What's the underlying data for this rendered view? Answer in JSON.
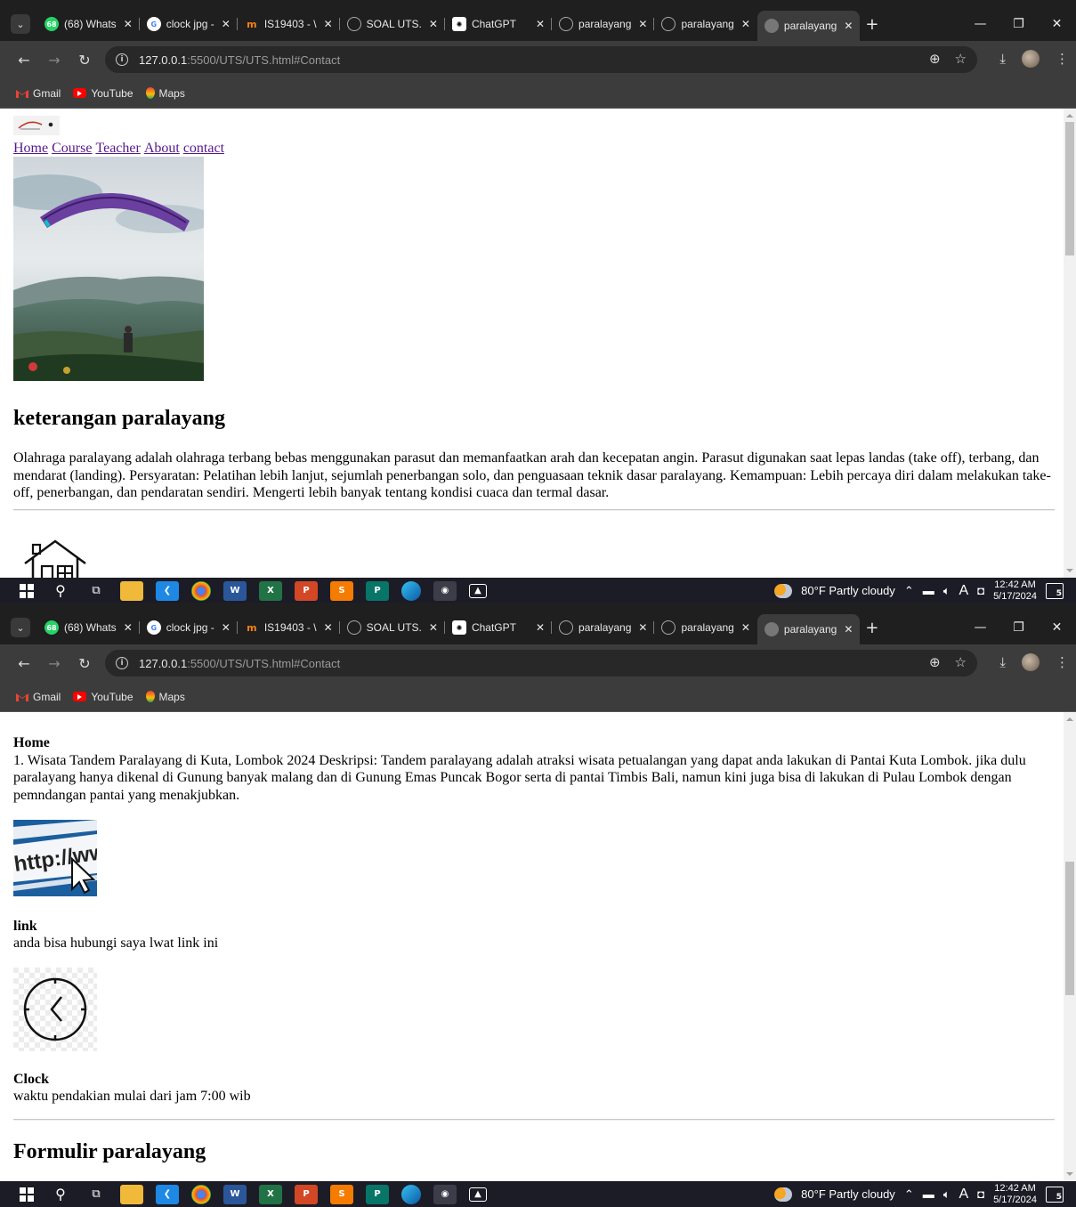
{
  "browser": {
    "tabs": [
      {
        "title": "(68) Whats",
        "favicon": "whatsapp-icon",
        "badge": "68",
        "color": "#25d366"
      },
      {
        "title": "clock jpg -",
        "favicon": "google-icon",
        "badge": "G",
        "color": "#ffffff"
      },
      {
        "title": "IS19403 - \\",
        "favicon": "moodle-icon",
        "badge": "m",
        "color": "#f98012"
      },
      {
        "title": "SOAL UTS.",
        "favicon": "globe-icon",
        "badge": "",
        "color": "#888888"
      },
      {
        "title": "ChatGPT",
        "favicon": "chatgpt-icon",
        "badge": "",
        "color": "#ffffff"
      },
      {
        "title": "paralayang",
        "favicon": "globe-icon",
        "badge": "",
        "color": "#888888"
      },
      {
        "title": "paralayang",
        "favicon": "globe-icon",
        "badge": "",
        "color": "#888888"
      },
      {
        "title": "paralayang",
        "favicon": "globe-icon",
        "badge": "",
        "color": "#888888",
        "active": true
      }
    ],
    "url_host": "127.0.0.1",
    "url_path": ":5500/UTS/UTS.html#Contact",
    "bookmarks": [
      "Gmail",
      "YouTube",
      "Maps"
    ]
  },
  "page_top": {
    "nav": [
      "Home",
      "Course",
      "Teacher",
      "About",
      "contact"
    ],
    "heading": "keterangan paralayang",
    "description": "Olahraga paralayang adalah olahraga terbang bebas menggunakan parasut dan memanfaatkan arah dan kecepatan angin. Parasut digunakan saat lepas landas (take off), terbang, dan mendarat (landing). Persyaratan: Pelatihan lebih lanjut, sejumlah penerbangan solo, dan penguasaan teknik dasar paralayang. Kemampuan: Lebih percaya diri dalam melakukan take-off, penerbangan, dan pendaratan sendiri. Mengerti lebih banyak tentang kondisi cuaca dan termal dasar."
  },
  "page_bottom": {
    "home_title": "Home",
    "home_text": "1. Wisata Tandem Paralayang di Kuta, Lombok 2024 Deskripsi: Tandem paralayang adalah atraksi wisata petualangan yang dapat anda lakukan di Pantai Kuta Lombok. jika dulu paralayang hanya dikenal di Gunung banyak malang dan di Gunung Emas Puncak Bogor serta di pantai Timbis Bali, namun kini juga bisa di lakukan di Pulau Lombok dengan pemndangan pantai yang menakjubkan.",
    "http_image_text": "http://www.",
    "link_title": "link",
    "link_text": "anda bisa hubungi saya lwat link ini",
    "clock_title": "Clock",
    "clock_text": "waktu pendakian mulai dari jam 7:00 wib",
    "form_title": "Formulir paralayang"
  },
  "taskbar": {
    "apps": [
      "file-explorer-icon",
      "vscode-icon",
      "chrome-icon",
      "word-icon",
      "excel-icon",
      "powerpoint-icon",
      "wps-spreadsheet-icon",
      "publisher-icon",
      "edge-icon",
      "chrome-profile-icon",
      "photos-icon"
    ],
    "weather": "80°F  Partly cloudy",
    "time": "12:42 AM",
    "date": "5/17/2024",
    "notifications": "5",
    "lang": "A"
  }
}
